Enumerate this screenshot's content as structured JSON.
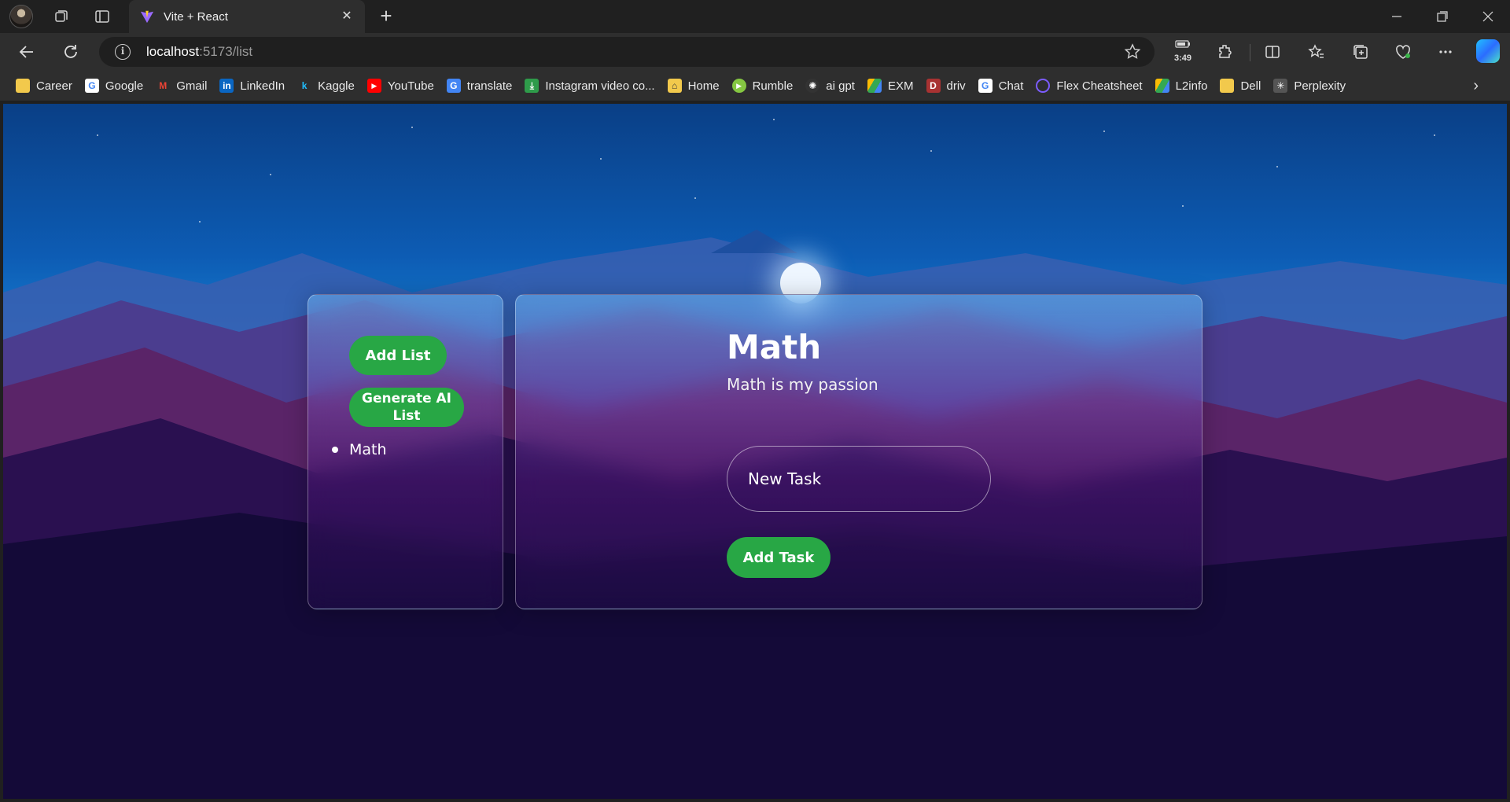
{
  "browser": {
    "tab_title": "Vite + React",
    "url_host": "localhost",
    "url_path": ":5173/list",
    "battery_time": "3:49"
  },
  "bookmarks": [
    {
      "label": "Career",
      "icon": "folder-icon",
      "color": "#f2c94c"
    },
    {
      "label": "Google",
      "icon": "google-icon",
      "color": "#4285f4"
    },
    {
      "label": "Gmail",
      "icon": "gmail-icon",
      "color": "#ea4335"
    },
    {
      "label": "LinkedIn",
      "icon": "linkedin-icon",
      "color": "#0a66c2"
    },
    {
      "label": "Kaggle",
      "icon": "kaggle-icon",
      "color": "#20beff"
    },
    {
      "label": "YouTube",
      "icon": "youtube-icon",
      "color": "#ff0000"
    },
    {
      "label": "translate",
      "icon": "translate-icon",
      "color": "#4285f4"
    },
    {
      "label": "Instagram video co...",
      "icon": "instagram-downloader-icon",
      "color": "#2e9b4a"
    },
    {
      "label": "Home",
      "icon": "home-icon",
      "color": "#f2c94c"
    },
    {
      "label": "Rumble",
      "icon": "rumble-icon",
      "color": "#85c742"
    },
    {
      "label": "ai gpt",
      "icon": "openai-icon",
      "color": "#444444"
    },
    {
      "label": "EXM",
      "icon": "drive-icon",
      "color": "#34a853"
    },
    {
      "label": "driv",
      "icon": "driv-icon",
      "color": "#a83232"
    },
    {
      "label": "Chat",
      "icon": "google-icon",
      "color": "#4285f4"
    },
    {
      "label": "Flex Cheatsheet",
      "icon": "flex-icon",
      "color": "#7c5cff"
    },
    {
      "label": "L2info",
      "icon": "drive-icon",
      "color": "#34a853"
    },
    {
      "label": "Dell",
      "icon": "folder-icon",
      "color": "#f2c94c"
    },
    {
      "label": "Perplexity",
      "icon": "perplexity-icon",
      "color": "#555555"
    }
  ],
  "app": {
    "add_list_label": "Add List",
    "generate_ai_label": "Generate AI List",
    "lists": [
      "Math"
    ],
    "selected_list": {
      "title": "Math",
      "description": "Math is my passion"
    },
    "new_task_placeholder": "New Task",
    "add_task_label": "Add Task"
  },
  "colors": {
    "button": "#28a745"
  }
}
